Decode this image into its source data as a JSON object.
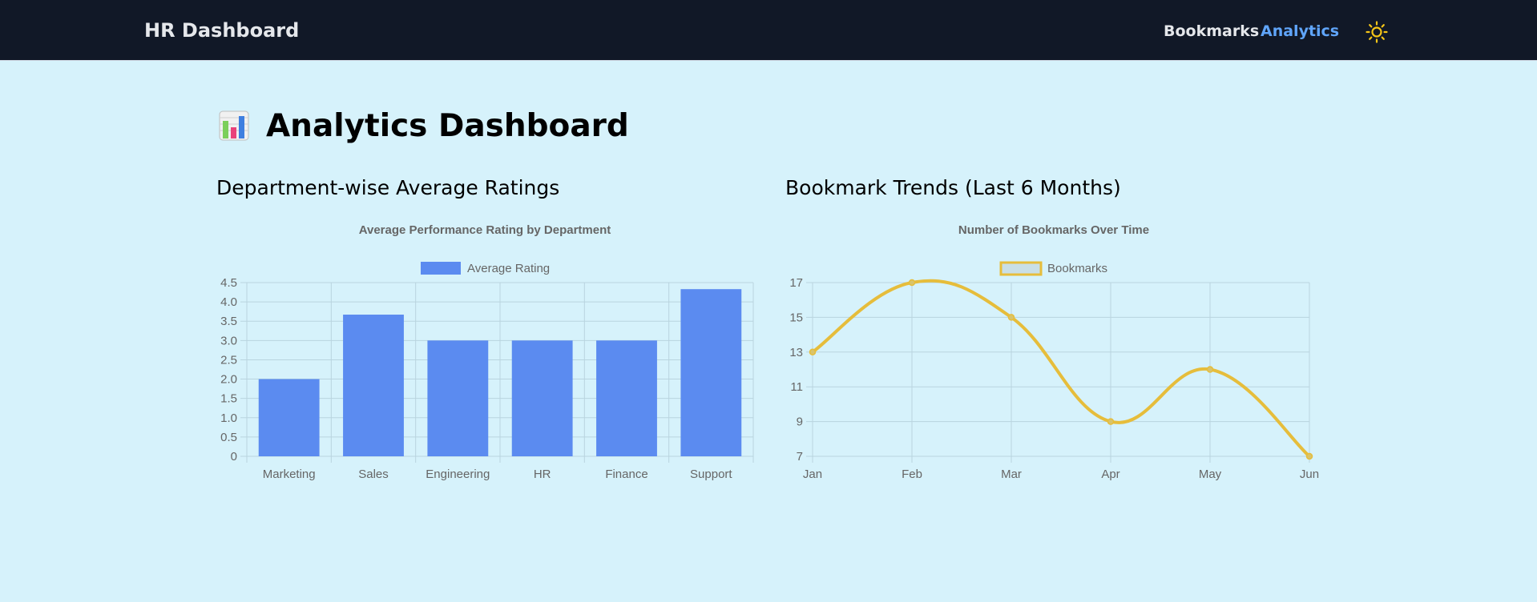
{
  "navbar": {
    "brand": "HR Dashboard",
    "links": [
      {
        "label": "Bookmarks",
        "active": false
      },
      {
        "label": "Analytics",
        "active": true
      }
    ],
    "theme_icon": "sun-icon"
  },
  "page": {
    "icon": "bar-chart-emoji-icon",
    "title": "Analytics Dashboard"
  },
  "sections": {
    "left_title": "Department-wise Average Ratings",
    "right_title": "Bookmark Trends (Last 6 Months)"
  },
  "colors": {
    "background": "#d6f2fb",
    "navbar": "#111827",
    "active_link": "#60a5fa",
    "bar": "#5b8bf0",
    "line": "#e6bd3b",
    "grid": "#b9d4df"
  },
  "chart_data": [
    {
      "type": "bar",
      "title": "Average Performance Rating by Department",
      "categories": [
        "Marketing",
        "Sales",
        "Engineering",
        "HR",
        "Finance",
        "Support"
      ],
      "series": [
        {
          "name": "Average Rating",
          "values": [
            2.0,
            3.67,
            3.0,
            3.0,
            3.0,
            4.33
          ]
        }
      ],
      "ylim": [
        0,
        4.5
      ],
      "yticks": [
        "0",
        "0.5",
        "1.0",
        "1.5",
        "2.0",
        "2.5",
        "3.0",
        "3.5",
        "4.0",
        "4.5"
      ],
      "grid": true,
      "legend": "top"
    },
    {
      "type": "line",
      "title": "Number of Bookmarks Over Time",
      "categories": [
        "Jan",
        "Feb",
        "Mar",
        "Apr",
        "May",
        "Jun"
      ],
      "series": [
        {
          "name": "Bookmarks",
          "values": [
            13,
            17,
            15,
            9,
            12,
            7
          ]
        }
      ],
      "ylim": [
        7,
        17
      ],
      "yticks": [
        "7",
        "9",
        "11",
        "13",
        "15",
        "17"
      ],
      "grid": true,
      "legend": "top"
    }
  ]
}
